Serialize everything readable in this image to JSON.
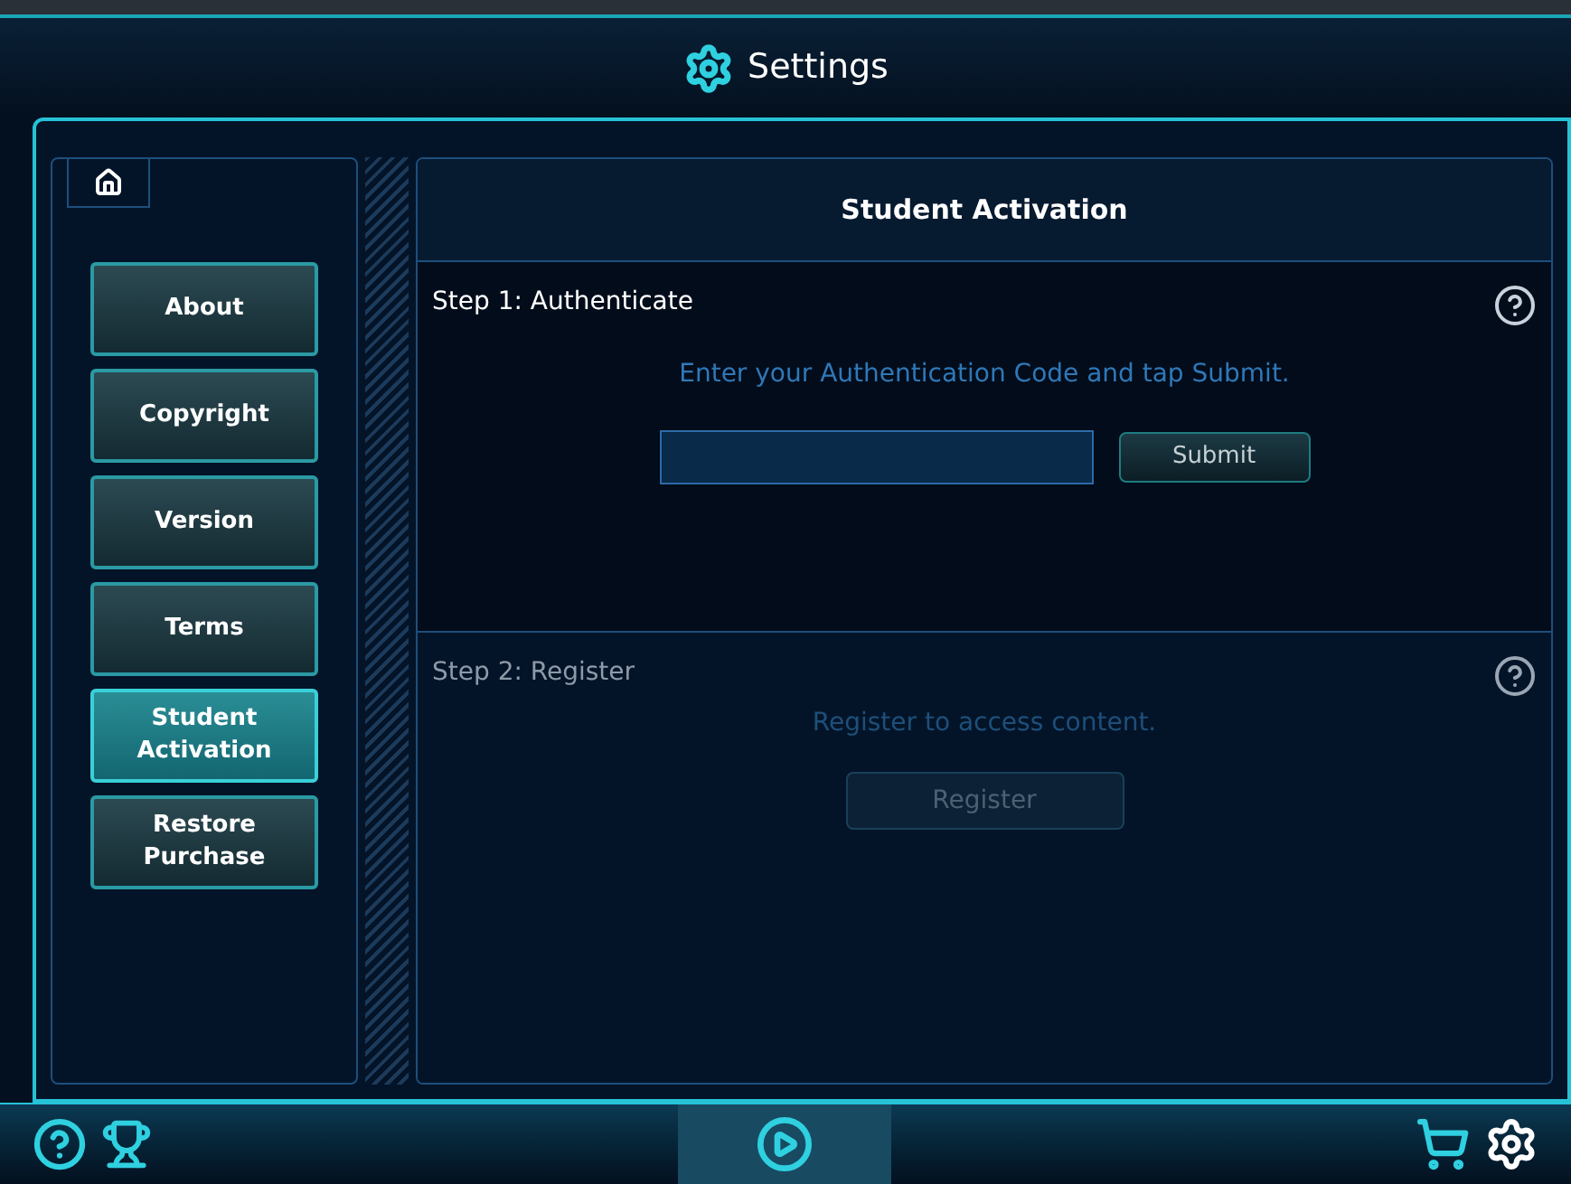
{
  "header": {
    "title": "Settings"
  },
  "sidebar": {
    "items": [
      {
        "label": "About",
        "selected": false
      },
      {
        "label": "Copyright",
        "selected": false
      },
      {
        "label": "Version",
        "selected": false
      },
      {
        "label": "Terms",
        "selected": false
      },
      {
        "label": "Student Activation",
        "selected": true
      },
      {
        "label": "Restore Purchase",
        "selected": false
      }
    ]
  },
  "panel": {
    "title": "Student Activation",
    "steps": [
      {
        "kind": "code-entry",
        "heading": "Step 1: Authenticate",
        "instruction": "Enter your Authentication Code and tap Submit.",
        "button": "Submit",
        "disabled": false
      },
      {
        "kind": "register",
        "heading": "Step 2: Register",
        "instruction": "Register to access content.",
        "button": "Register",
        "disabled": true
      }
    ]
  }
}
